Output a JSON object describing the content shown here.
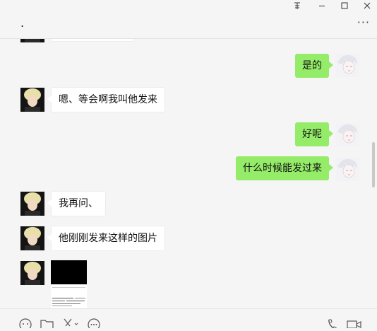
{
  "window": {
    "title": ".",
    "controls": [
      "pin-icon",
      "minimize-icon",
      "maximize-icon",
      "close-icon"
    ],
    "more_label": "···"
  },
  "messages": [
    {
      "side": "left",
      "type": "text",
      "text": ""
    },
    {
      "side": "right",
      "type": "text",
      "text": "是的"
    },
    {
      "side": "left",
      "type": "text",
      "text": "嗯、等会啊我叫他发来"
    },
    {
      "side": "right",
      "type": "text",
      "text": "好呢"
    },
    {
      "side": "right",
      "type": "text",
      "text": "什么时候能发过来"
    },
    {
      "side": "left",
      "type": "text",
      "text": "我再问、"
    },
    {
      "side": "left",
      "type": "text",
      "text": "他刚刚发来这样的图片"
    },
    {
      "side": "left",
      "type": "image",
      "text": ""
    }
  ],
  "toolbar": {
    "left_icons": [
      "emoji-icon",
      "folder-icon",
      "scissors-icon",
      "chat-history-icon"
    ],
    "right_icons": [
      "phone-icon",
      "video-icon"
    ]
  },
  "colors": {
    "self_bubble": "#95ec69",
    "other_bubble": "#ffffff",
    "background": "#f5f5f5"
  }
}
